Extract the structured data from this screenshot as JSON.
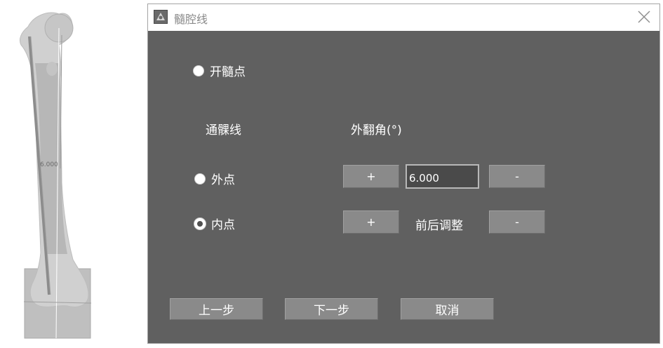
{
  "viewport": {
    "measure_label": "6.000"
  },
  "dialog": {
    "title": "髓腔线",
    "icons": {
      "app": "app-logo-icon",
      "close": "close-icon"
    },
    "entry_point": {
      "label": "开髓点",
      "checked": false
    },
    "section_labels": {
      "through_line": "通髁线",
      "valgus_angle": "外翻角(°)",
      "ap_adjust": "前后调整"
    },
    "condyle_options": [
      {
        "label": "外点",
        "checked": false
      },
      {
        "label": "内点",
        "checked": true
      }
    ],
    "valgus": {
      "plus_label": "+",
      "minus_label": "-",
      "value": "6.000"
    },
    "adjust": {
      "plus_label": "+",
      "minus_label": "-"
    },
    "nav": {
      "prev": "上一步",
      "next": "下一步",
      "cancel": "取消"
    }
  }
}
